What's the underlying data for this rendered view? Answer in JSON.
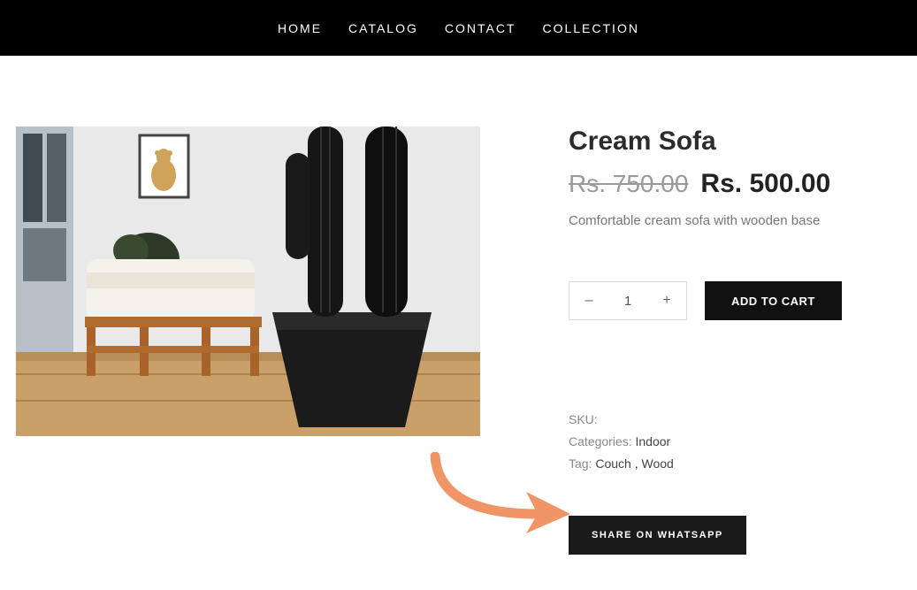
{
  "nav": {
    "home": "HOME",
    "catalog": "CATALOG",
    "contact": "CONTACT",
    "collection": "COLLECTION"
  },
  "product": {
    "title": "Cream Sofa",
    "price_old": "Rs. 750.00",
    "price_new": "Rs. 500.00",
    "description": "Comfortable cream sofa with wooden base",
    "quantity": "1",
    "add_to_cart_label": "ADD TO CART",
    "share_label": "SHARE ON WHATSAPP"
  },
  "meta": {
    "sku_label": "SKU:",
    "categories_label": "Categories:",
    "categories_value": "Indoor",
    "tag_label": "Tag:",
    "tag1": "Couch",
    "tag_sep": " , ",
    "tag2": "Wood"
  },
  "qty": {
    "minus": "–",
    "plus": "+"
  }
}
